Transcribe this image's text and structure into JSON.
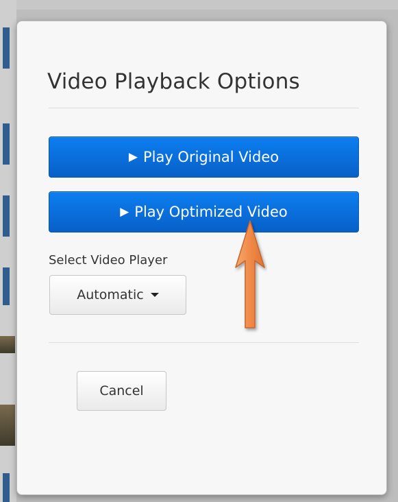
{
  "modal": {
    "title": "Video Playback Options",
    "play_original_label": "Play Original Video",
    "play_optimized_label": "Play Optimized Video",
    "play_glyph": "▶",
    "select_label": "Select Video Player",
    "player_selected": "Automatic",
    "cancel_label": "Cancel"
  },
  "annotation": {
    "arrow_color": "#f0894a",
    "points_to": "play-optimized-button"
  },
  "colors": {
    "primary_button": "#0b74e2",
    "modal_background": "#f7f7f7"
  }
}
